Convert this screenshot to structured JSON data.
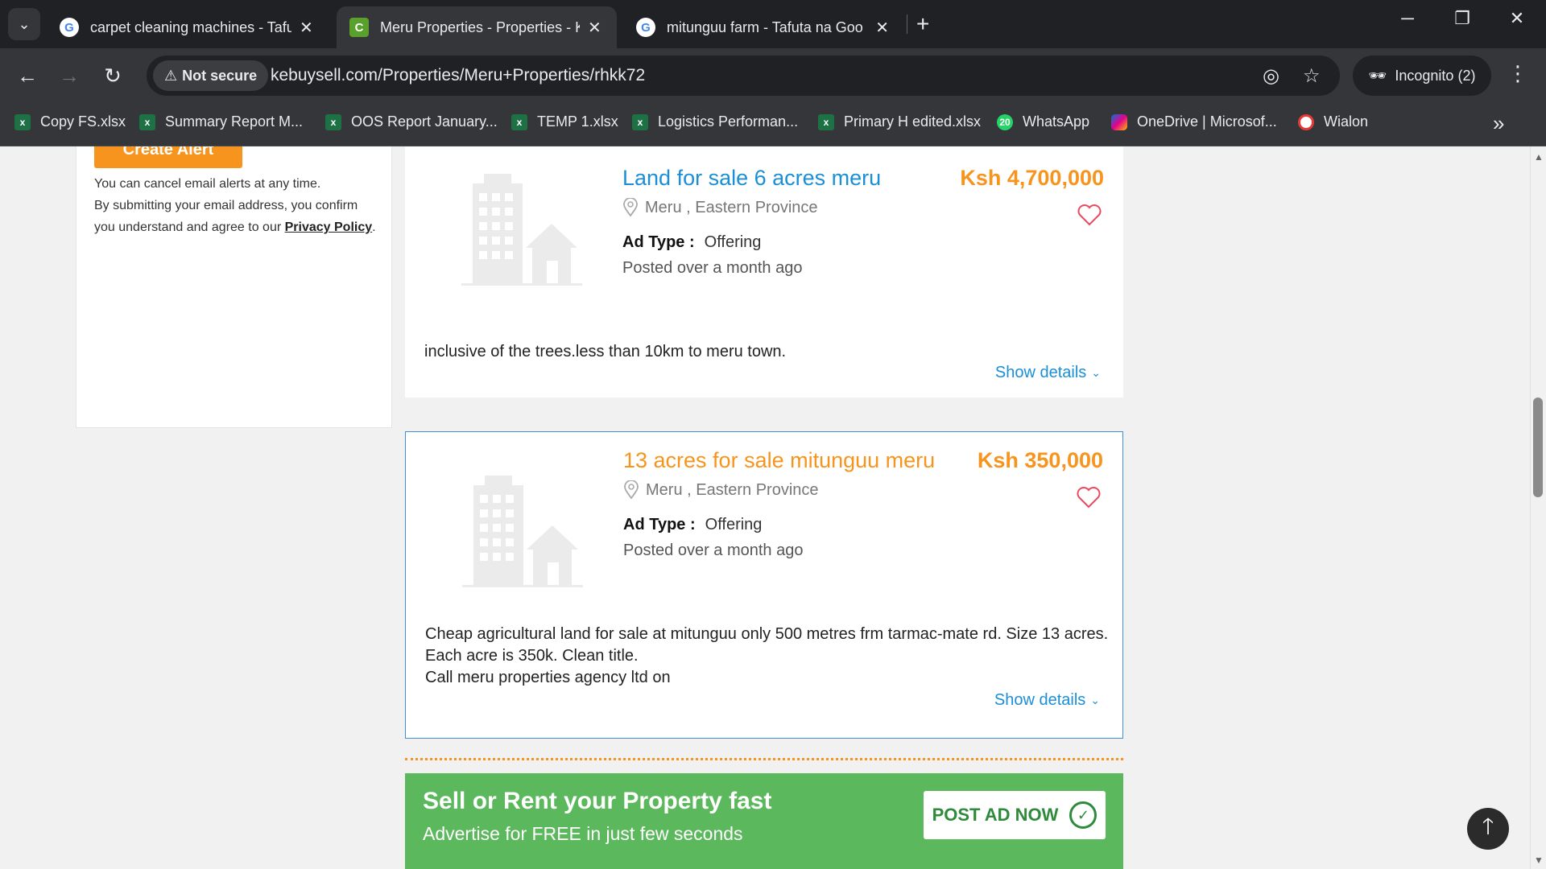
{
  "browser": {
    "tabs": [
      {
        "title": "carpet cleaning machines - Tafu",
        "favicon": "google-icon",
        "active": false
      },
      {
        "title": "Meru Properties - Properties - K",
        "favicon": "c-icon",
        "active": true
      },
      {
        "title": "mitunguu farm - Tafuta na Goo",
        "favicon": "google-icon",
        "active": false
      }
    ],
    "security_label": "Not secure",
    "url": "kebuysell.com/Properties/Meru+Properties/rhkk72",
    "profile_label": "Incognito (2)",
    "bookmarks": [
      {
        "label": "Copy FS.xlsx",
        "icon": "excel-icon"
      },
      {
        "label": "Summary Report M...",
        "icon": "excel-icon"
      },
      {
        "label": "OOS Report January...",
        "icon": "excel-icon"
      },
      {
        "label": "TEMP 1.xlsx",
        "icon": "excel-icon"
      },
      {
        "label": "Logistics Performan...",
        "icon": "excel-icon"
      },
      {
        "label": "Primary H edited.xlsx",
        "icon": "excel-icon"
      },
      {
        "label": "WhatsApp",
        "icon": "whatsapp-icon",
        "badge": "20"
      },
      {
        "label": "OneDrive | Microsof...",
        "icon": "onedrive-icon"
      },
      {
        "label": "Wialon",
        "icon": "wialon-icon"
      }
    ]
  },
  "sidebar": {
    "create_alert_label": "Create Alert",
    "alert_line1": "You can cancel email alerts at any time.",
    "alert_line2": "By submitting your email address, you confirm you understand and agree to our",
    "privacy_link": "Privacy Policy",
    "period": "."
  },
  "listings": [
    {
      "title": "Land for sale 6 acres meru",
      "price": "Ksh 4,700,000",
      "location": "Meru , Eastern Province",
      "ad_type_label": "Ad Type :",
      "ad_type_value": "Offering",
      "posted": "Posted over a month ago",
      "description": "inclusive of the trees.less than 10km to meru town.",
      "show_details": "Show details"
    },
    {
      "title": "13 acres for sale mitunguu meru",
      "price": "Ksh 350,000",
      "location": "Meru , Eastern Province",
      "ad_type_label": "Ad Type :",
      "ad_type_value": "Offering",
      "posted": "Posted over a month ago",
      "description": "Cheap agricultural land for sale at mitunguu only 500 metres frm tarmac-mate rd. Size 13 acres. Each acre is 350k. Clean title.",
      "description_line2": "Call meru properties agency ltd on",
      "show_details": "Show details"
    }
  ],
  "banner": {
    "title": "Sell or Rent your Property fast",
    "subtitle": "Advertise for FREE in just few seconds",
    "button_label": "POST AD NOW"
  },
  "colors": {
    "accent_orange": "#f7941d",
    "link_blue": "#1a8fd8",
    "banner_green": "#5cb85c"
  }
}
